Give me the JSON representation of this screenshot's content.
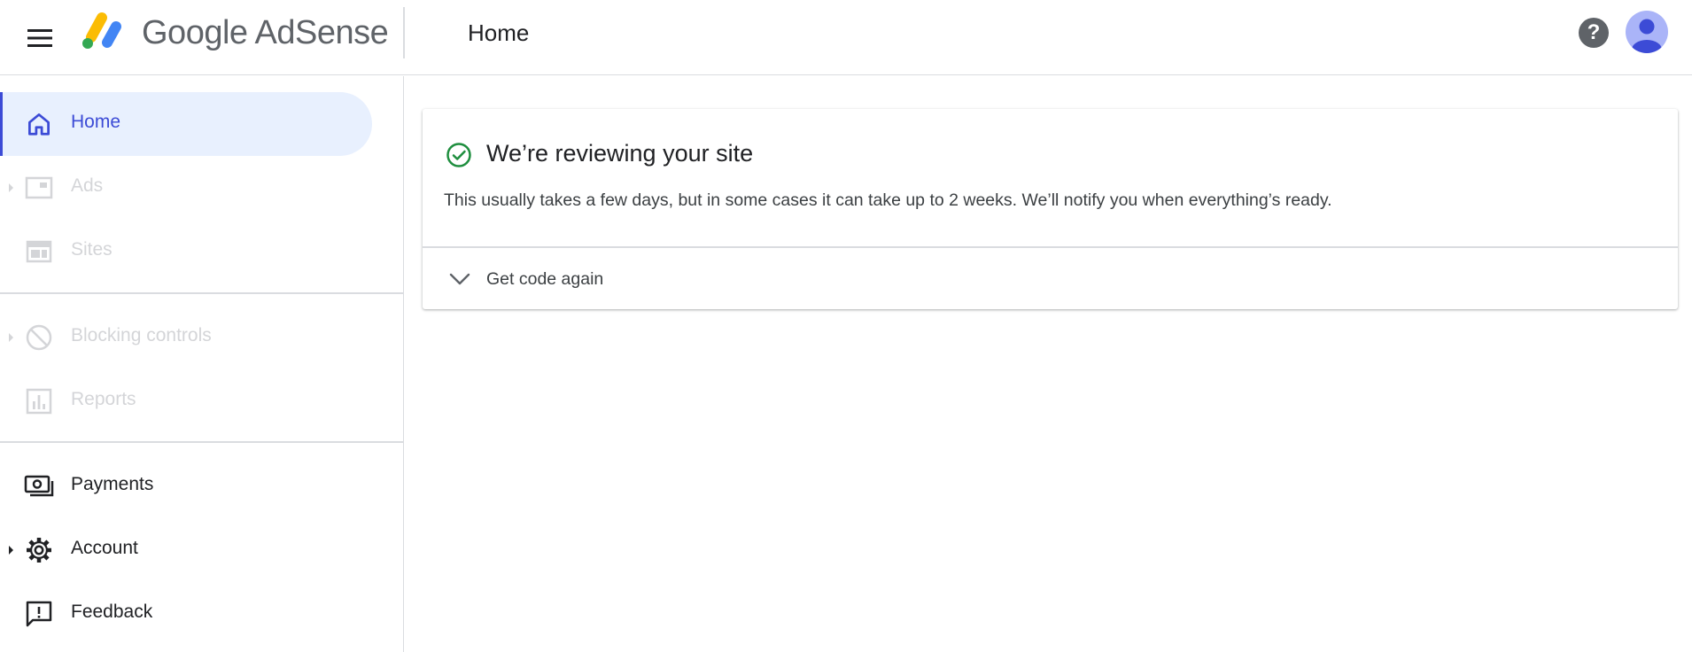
{
  "header": {
    "menu_icon": "hamburger-menu-icon",
    "brand_google": "Google",
    "brand_product": "AdSense",
    "title": "Home",
    "help_icon": "help-icon",
    "avatar_icon": "account-avatar-icon"
  },
  "sidebar": {
    "items": [
      {
        "label": "Home",
        "icon": "home-icon",
        "state": "active"
      },
      {
        "label": "Ads",
        "icon": "ads-icon",
        "state": "disabled"
      },
      {
        "label": "Sites",
        "icon": "sites-icon",
        "state": "disabled"
      },
      {
        "label": "Blocking controls",
        "icon": "block-icon",
        "state": "disabled"
      },
      {
        "label": "Reports",
        "icon": "bar-chart-icon",
        "state": "disabled"
      },
      {
        "label": "Payments",
        "icon": "payments-icon",
        "state": "normal"
      },
      {
        "label": "Account",
        "icon": "gear-icon",
        "state": "normal"
      },
      {
        "label": "Feedback",
        "icon": "feedback-icon",
        "state": "normal"
      }
    ]
  },
  "main": {
    "card": {
      "title": "We’re reviewing your site",
      "body": "This usually takes a few days, but in some cases it can take up to 2 weeks. We’ll notify you when everything’s ready.",
      "status_icon": "check-circle-icon",
      "expander_label": "Get code again",
      "expander_icon": "chevron-down-icon"
    }
  },
  "colors": {
    "accent": "#3c4bd6",
    "active_bg": "#e8f0fe",
    "success": "#1e8e3e",
    "disabled_text": "#d4d5d8",
    "logo_yellow": "#fbbc04",
    "logo_green": "#34a853",
    "logo_blue": "#4285f4"
  }
}
